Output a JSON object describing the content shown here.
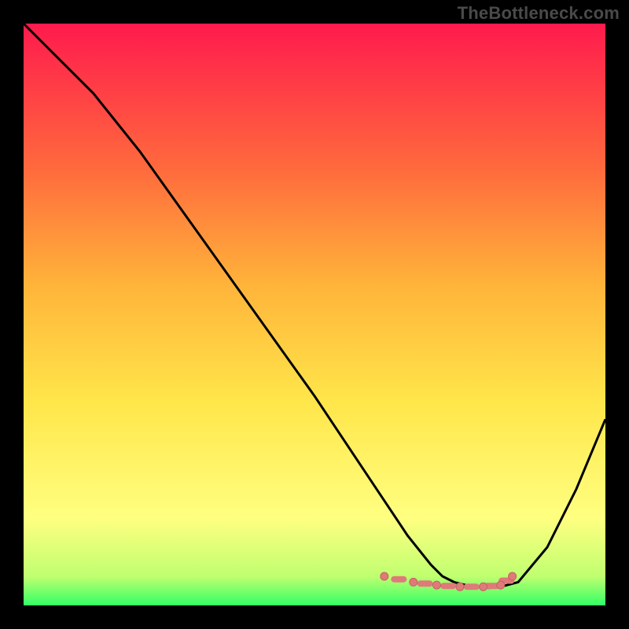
{
  "watermark": "TheBottleneck.com",
  "colors": {
    "background": "#000000",
    "gradient_top": "#ff1a4d",
    "gradient_upper_mid": "#ff7a33",
    "gradient_mid": "#ffd633",
    "gradient_lower_mid": "#ffff66",
    "gradient_bottom": "#33ff66",
    "curve": "#000000",
    "marker": "#e07a7a"
  },
  "chart_data": {
    "type": "line",
    "title": "",
    "xlabel": "",
    "ylabel": "",
    "xlim": [
      0,
      100
    ],
    "ylim": [
      0,
      100
    ],
    "series": [
      {
        "name": "bottleneck-curve",
        "x": [
          0,
          6,
          12,
          20,
          30,
          40,
          50,
          58,
          62,
          66,
          70,
          72,
          74,
          76,
          78,
          80,
          82,
          85,
          90,
          95,
          100
        ],
        "y": [
          100,
          94,
          88,
          78,
          64,
          50,
          36,
          24,
          18,
          12,
          7,
          5,
          4,
          3.5,
          3.2,
          3,
          3.2,
          4,
          10,
          20,
          32
        ]
      }
    ],
    "markers": {
      "name": "highlight-region",
      "x_start": 62,
      "x_end": 84,
      "y": 3.2,
      "points_x": [
        62,
        67,
        71,
        75,
        79,
        82,
        84
      ],
      "points_y": [
        5,
        4,
        3.5,
        3.2,
        3.2,
        3.5,
        5
      ]
    }
  }
}
